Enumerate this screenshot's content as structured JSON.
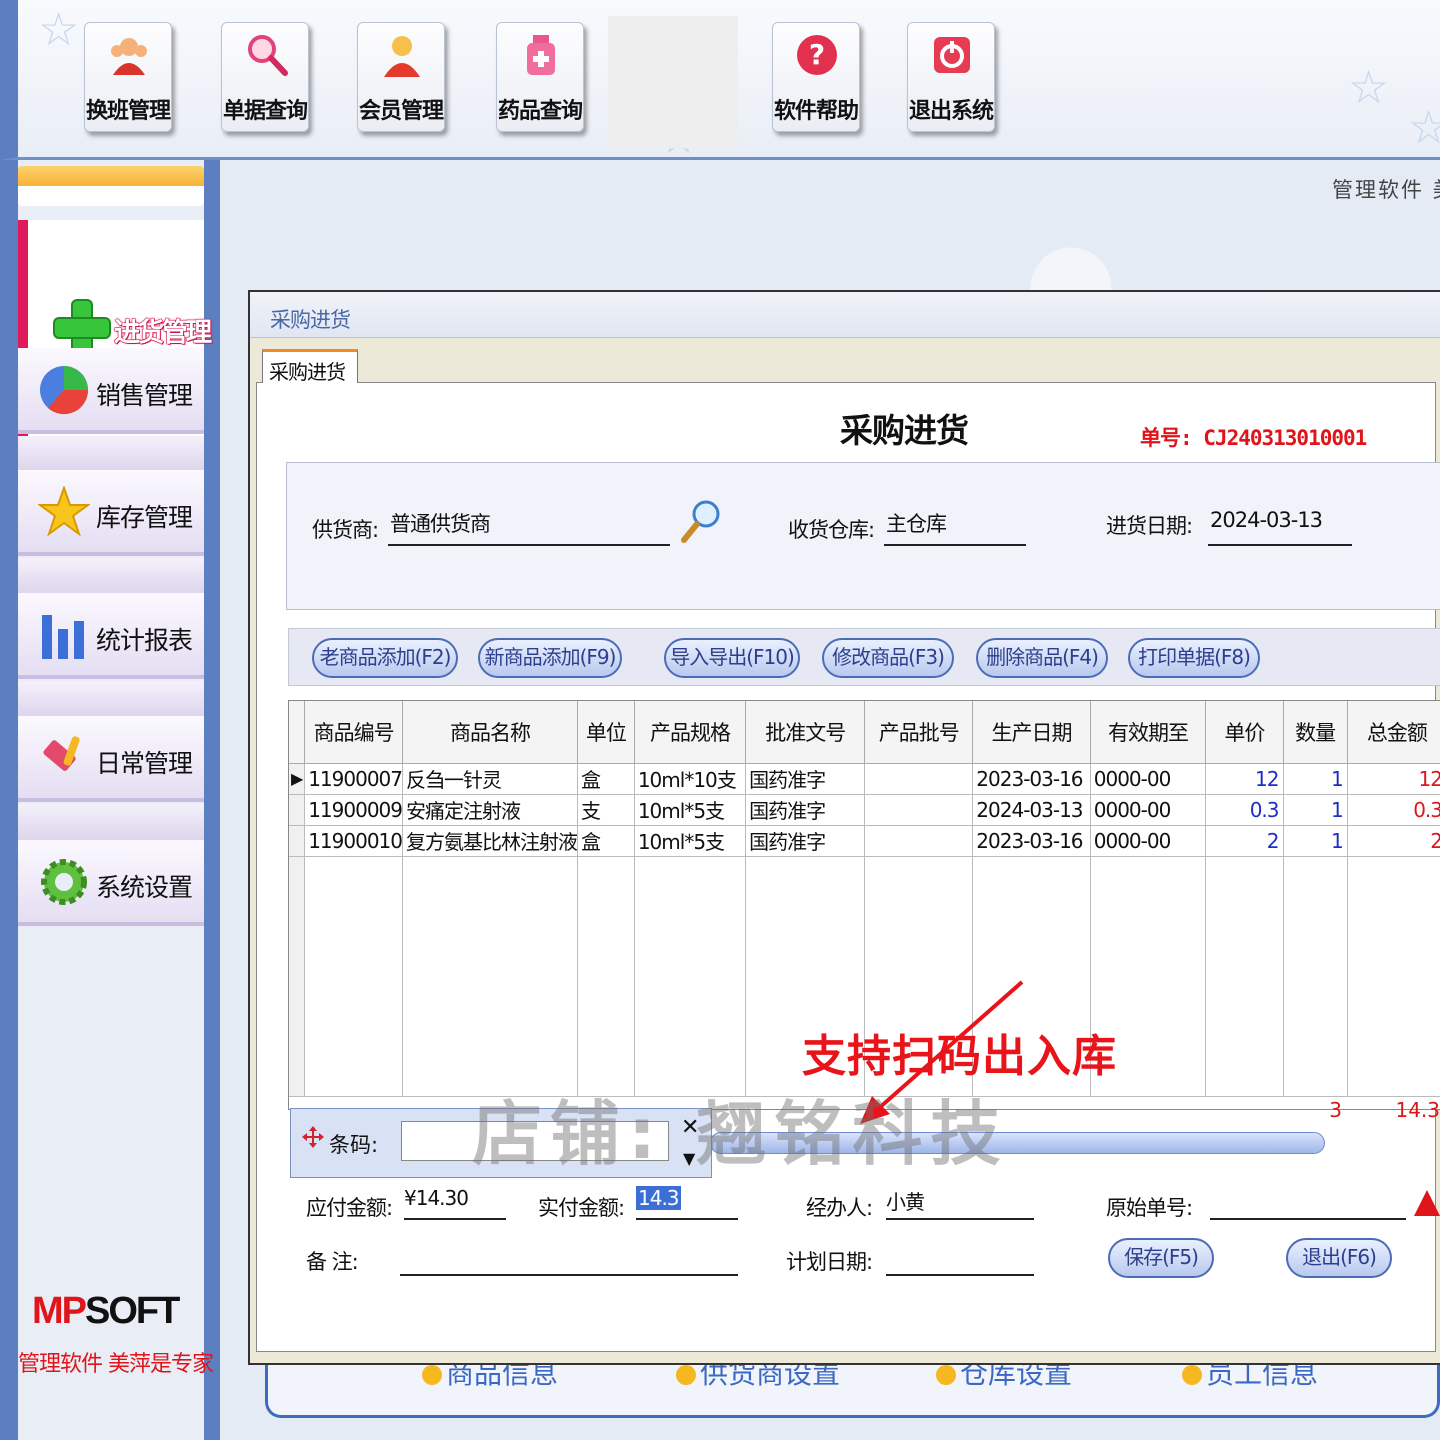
{
  "toolbar": {
    "buttons": [
      {
        "label": "换班管理",
        "icon": "shift-users-icon"
      },
      {
        "label": "单据查询",
        "icon": "magnifier-icon"
      },
      {
        "label": "会员管理",
        "icon": "member-icon"
      },
      {
        "label": "药品查询",
        "icon": "medicine-bottle-icon"
      },
      {
        "label": "软件帮助",
        "icon": "help-icon"
      },
      {
        "label": "退出系统",
        "icon": "power-icon"
      }
    ],
    "tagline": "管理软件 美"
  },
  "sidebar": {
    "active": {
      "label": "进货管理",
      "icon": "plus-icon"
    },
    "items": [
      {
        "label": "销售管理",
        "icon": "pie-chart-icon"
      },
      {
        "label": "库存管理",
        "icon": "star-icon"
      },
      {
        "label": "统计报表",
        "icon": "bar-chart-icon"
      },
      {
        "label": "日常管理",
        "icon": "tools-icon"
      },
      {
        "label": "系统设置",
        "icon": "gear-icon"
      }
    ],
    "brand": {
      "part1": "MP",
      "part2": "SOFT",
      "sub": "管理软件 美萍是专家"
    }
  },
  "background_links": [
    "商品信息",
    "供货商设置",
    "仓库设置",
    "员工信息"
  ],
  "window": {
    "title": "采购进货",
    "tab": "采购进货",
    "form_title": "采购进货",
    "order_no": "单号: CJ240313010001",
    "supplier_label": "供货商:",
    "supplier_value": "普通供货商",
    "warehouse_label": "收货仓库:",
    "warehouse_value": "主仓库",
    "date_label": "进货日期:",
    "date_value": "2024-03-13"
  },
  "actions": [
    "老商品添加(F2)",
    "新商品添加(F9)",
    "导入导出(F10)",
    "修改商品(F3)",
    "删除商品(F4)",
    "打印单据(F8)"
  ],
  "table": {
    "columns": [
      "商品编号",
      "商品名称",
      "单位",
      "产品规格",
      "批准文号",
      "产品批号",
      "生产日期",
      "有效期至",
      "单价",
      "数量",
      "总金额"
    ],
    "rows": [
      [
        "11900007",
        "反刍一针灵",
        "盒",
        "10ml*10支",
        "国药准字",
        "",
        "2023-03-16",
        "0000-00",
        "12",
        "1",
        "12"
      ],
      [
        "11900009",
        "安痛定注射液",
        "支",
        "10ml*5支",
        "国药准字",
        "",
        "2024-03-13",
        "0000-00",
        "0.3",
        "1",
        "0.3"
      ],
      [
        "11900010",
        "复方氨基比林注射液",
        "盒",
        "10ml*5支",
        "国药准字",
        "",
        "2023-03-16",
        "0000-00",
        "2",
        "1",
        "2"
      ]
    ],
    "total_qty": "3",
    "total_amount": "14.3"
  },
  "barcode": {
    "label": "条码:",
    "value": ""
  },
  "annotation": "支持扫码出入库",
  "watermark": "店铺: 翘铭科技",
  "footer": {
    "payable_label": "应付金额:",
    "payable_value": "¥14.30",
    "paid_label": "实付金额:",
    "paid_value": "14.3",
    "handler_label": "经办人:",
    "handler_value": "小黄",
    "orig_label": "原始单号:",
    "orig_value": "",
    "remark_label": "备    注:",
    "remark_value": "",
    "plan_label": "计划日期:",
    "plan_value": "",
    "save_label": "保存(F5)",
    "exit_label": "退出(F6)"
  },
  "colors": {
    "accent_red": "#e0151b",
    "sidebar_blue": "#5b7fc0",
    "link_blue": "#1d2ec8"
  }
}
